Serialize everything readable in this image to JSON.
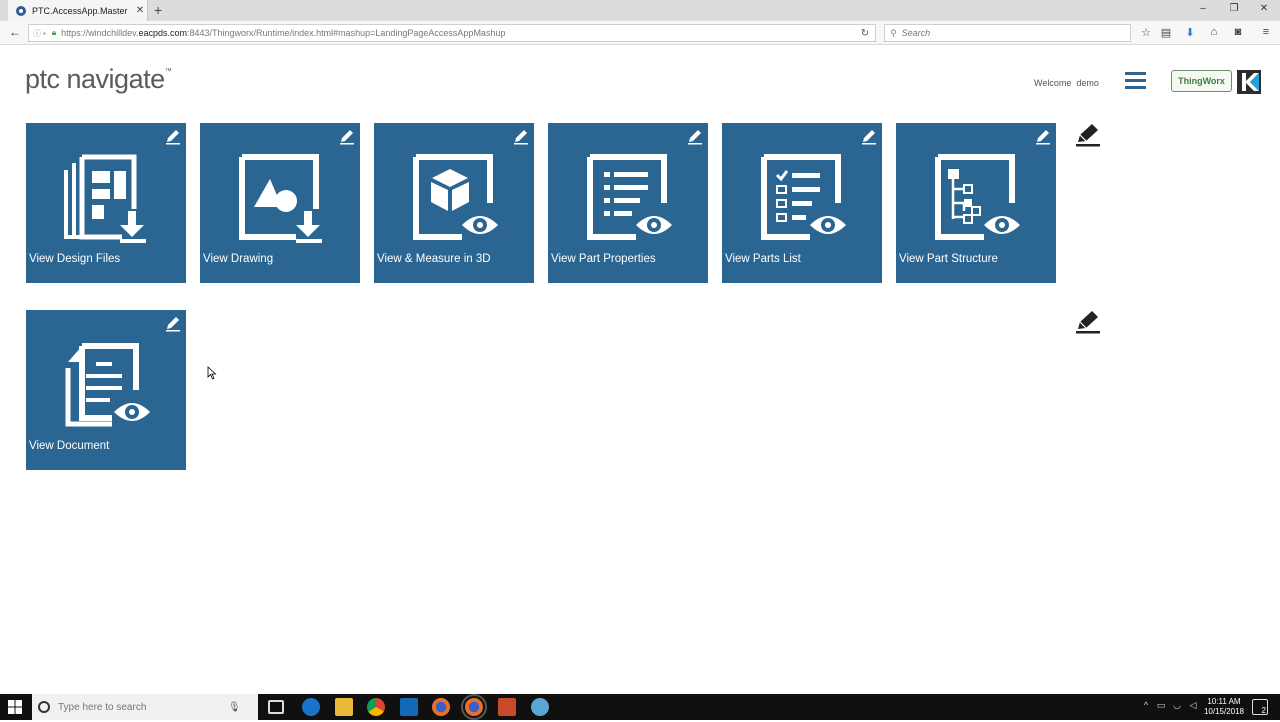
{
  "browser": {
    "tab_title": "PTC.AccessApp.Master",
    "url_prefix": "https://windchilldev.",
    "url_host": "eacpds.com",
    "url_rest": ":8443/Thingworx/Runtime/index.html#mashup=LandingPageAccessAppMashup",
    "search_placeholder": "Search"
  },
  "header": {
    "logo_text": "ptc navigate",
    "logo_mark": "™",
    "welcome_label": "Welcome",
    "username": "demo",
    "thingworx_label": "ThingWorx"
  },
  "tiles": [
    {
      "label": "View Design Files",
      "icon": "design-files-icon"
    },
    {
      "label": "View Drawing",
      "icon": "drawing-icon"
    },
    {
      "label": "View & Measure in 3D",
      "icon": "3d-cube-icon"
    },
    {
      "label": "View Part Properties",
      "icon": "part-properties-icon"
    },
    {
      "label": "View Parts List",
      "icon": "parts-list-icon"
    },
    {
      "label": "View Part Structure",
      "icon": "part-structure-icon"
    },
    {
      "label": "View Document",
      "icon": "document-icon"
    }
  ],
  "taskbar": {
    "search_placeholder": "Type here to search",
    "time": "10:11 AM",
    "date": "10/15/2018",
    "notification_count": "2"
  },
  "colors": {
    "tile": "#2b6592",
    "accent": "#2c6592"
  }
}
